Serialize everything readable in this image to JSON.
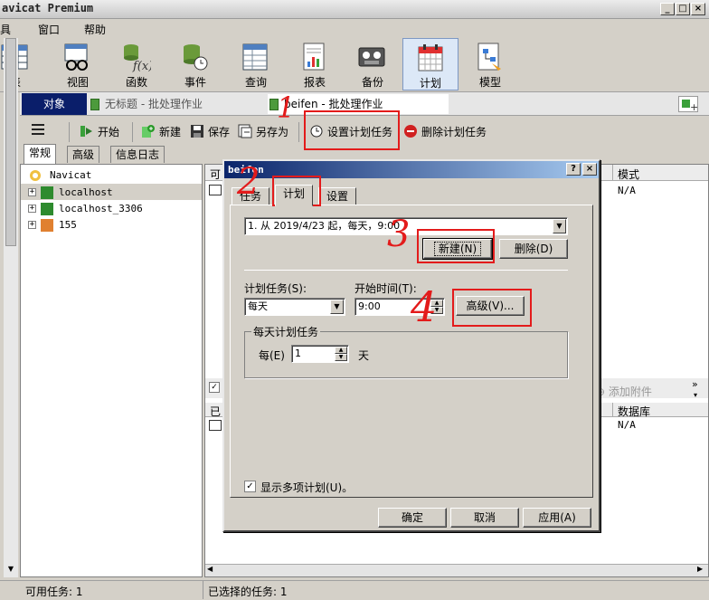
{
  "window": {
    "title": "avicat Premium"
  },
  "menu": [
    "具",
    "窗口",
    "帮助"
  ],
  "toolbar": [
    {
      "label": "表",
      "icon": "table-icon"
    },
    {
      "label": "视图",
      "icon": "view-icon"
    },
    {
      "label": "函数",
      "icon": "function-icon"
    },
    {
      "label": "事件",
      "icon": "event-icon"
    },
    {
      "label": "查询",
      "icon": "query-icon"
    },
    {
      "label": "报表",
      "icon": "report-icon"
    },
    {
      "label": "备份",
      "icon": "backup-icon"
    },
    {
      "label": "计划",
      "icon": "schedule-icon"
    },
    {
      "label": "模型",
      "icon": "model-icon"
    }
  ],
  "tabs": {
    "object": "对象",
    "untitled": "无标题 - 批处理作业",
    "current": "beifen - 批处理作业"
  },
  "subbar": {
    "start": "开始",
    "new": "新建",
    "save": "保存",
    "saveas": "另存为",
    "set_schedule": "设置计划任务",
    "delete_schedule": "删除计划任务"
  },
  "lefttabs": [
    "常规",
    "高级",
    "信息日志"
  ],
  "tree": {
    "root": "Navicat",
    "items": [
      "localhost",
      "localhost_3306",
      "155"
    ]
  },
  "right": {
    "col1": "可",
    "col_mode": "模式",
    "mode_value": "N/A",
    "col2": "已",
    "col_db": "数据库",
    "db_value": "N/A",
    "attach": "添加附件"
  },
  "status": {
    "left": "可用任务: 1",
    "right": "已选择的任务: 1"
  },
  "dialog": {
    "title": "beifen",
    "tabs": [
      "任务",
      "计划",
      "设置"
    ],
    "schedule_entry": "1. 从 2019/4/23 起，每天，9:00",
    "btn_new": "新建(N)",
    "btn_delete": "删除(D)",
    "lbl_schedule": "计划任务(S):",
    "schedule_value": "每天",
    "lbl_start": "开始时间(T):",
    "start_value": "9:00",
    "btn_advanced": "高级(V)...",
    "group_title": "每天计划任务",
    "every_label": "每(E)",
    "every_value": "1",
    "day_label": "天",
    "show_multi": "显示多项计划(U)。",
    "ok": "确定",
    "cancel": "取消",
    "apply": "应用(A)"
  },
  "annotations": [
    "1",
    "2",
    "3",
    "4"
  ]
}
